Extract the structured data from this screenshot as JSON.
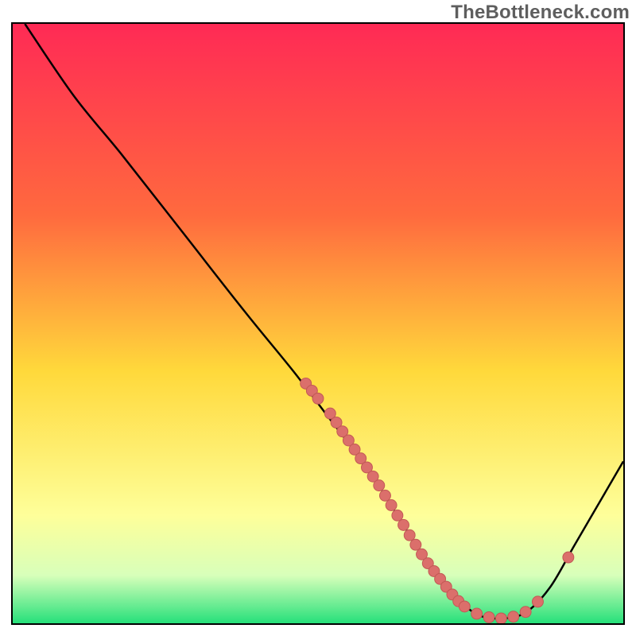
{
  "watermark": "TheBottleneck.com",
  "colors": {
    "frame": "#000000",
    "curve": "#000000",
    "marker_fill": "#db6f6b",
    "marker_stroke": "#c25955",
    "grad_top": "#ff2a55",
    "grad_mid1": "#ff8a3a",
    "grad_mid2": "#ffe84a",
    "grad_low1": "#fbfccb",
    "grad_bottom": "#2ed573"
  },
  "chart_data": {
    "type": "line",
    "title": "",
    "xlabel": "",
    "ylabel": "",
    "x_range": [
      0,
      100
    ],
    "y_range": [
      0,
      100
    ],
    "curve_points": [
      {
        "x": 2,
        "y": 100
      },
      {
        "x": 10,
        "y": 88
      },
      {
        "x": 18,
        "y": 78
      },
      {
        "x": 28,
        "y": 65
      },
      {
        "x": 38,
        "y": 52
      },
      {
        "x": 46,
        "y": 42
      },
      {
        "x": 52,
        "y": 34
      },
      {
        "x": 58,
        "y": 26
      },
      {
        "x": 63,
        "y": 18
      },
      {
        "x": 68,
        "y": 10
      },
      {
        "x": 72,
        "y": 5
      },
      {
        "x": 76,
        "y": 1.5
      },
      {
        "x": 80,
        "y": 0.8
      },
      {
        "x": 84,
        "y": 1.8
      },
      {
        "x": 88,
        "y": 6
      },
      {
        "x": 92,
        "y": 13
      },
      {
        "x": 96,
        "y": 20
      },
      {
        "x": 100,
        "y": 27
      }
    ],
    "markers": [
      {
        "x": 48,
        "y": 40
      },
      {
        "x": 49,
        "y": 38.8
      },
      {
        "x": 50,
        "y": 37.5
      },
      {
        "x": 52,
        "y": 35
      },
      {
        "x": 53,
        "y": 33.5
      },
      {
        "x": 54,
        "y": 32
      },
      {
        "x": 55,
        "y": 30.5
      },
      {
        "x": 56,
        "y": 29
      },
      {
        "x": 57,
        "y": 27.5
      },
      {
        "x": 58,
        "y": 26
      },
      {
        "x": 59,
        "y": 24.5
      },
      {
        "x": 60,
        "y": 23
      },
      {
        "x": 61,
        "y": 21.3
      },
      {
        "x": 62,
        "y": 19.7
      },
      {
        "x": 63,
        "y": 18
      },
      {
        "x": 64,
        "y": 16.4
      },
      {
        "x": 65,
        "y": 14.7
      },
      {
        "x": 66,
        "y": 13.1
      },
      {
        "x": 67,
        "y": 11.5
      },
      {
        "x": 68,
        "y": 10
      },
      {
        "x": 69,
        "y": 8.7
      },
      {
        "x": 70,
        "y": 7.4
      },
      {
        "x": 71,
        "y": 6.1
      },
      {
        "x": 72,
        "y": 4.8
      },
      {
        "x": 73,
        "y": 3.7
      },
      {
        "x": 74,
        "y": 2.8
      },
      {
        "x": 76,
        "y": 1.6
      },
      {
        "x": 78,
        "y": 1.0
      },
      {
        "x": 80,
        "y": 0.8
      },
      {
        "x": 82,
        "y": 1.1
      },
      {
        "x": 84,
        "y": 1.9
      },
      {
        "x": 86,
        "y": 3.6
      },
      {
        "x": 91,
        "y": 11.0
      }
    ],
    "gradient_stops": [
      {
        "offset": 0,
        "color": "#ff2a55"
      },
      {
        "offset": 0.32,
        "color": "#ff6a3e"
      },
      {
        "offset": 0.58,
        "color": "#ffd93b"
      },
      {
        "offset": 0.82,
        "color": "#feff9a"
      },
      {
        "offset": 0.92,
        "color": "#d8ffba"
      },
      {
        "offset": 1.0,
        "color": "#26e07a"
      }
    ]
  }
}
